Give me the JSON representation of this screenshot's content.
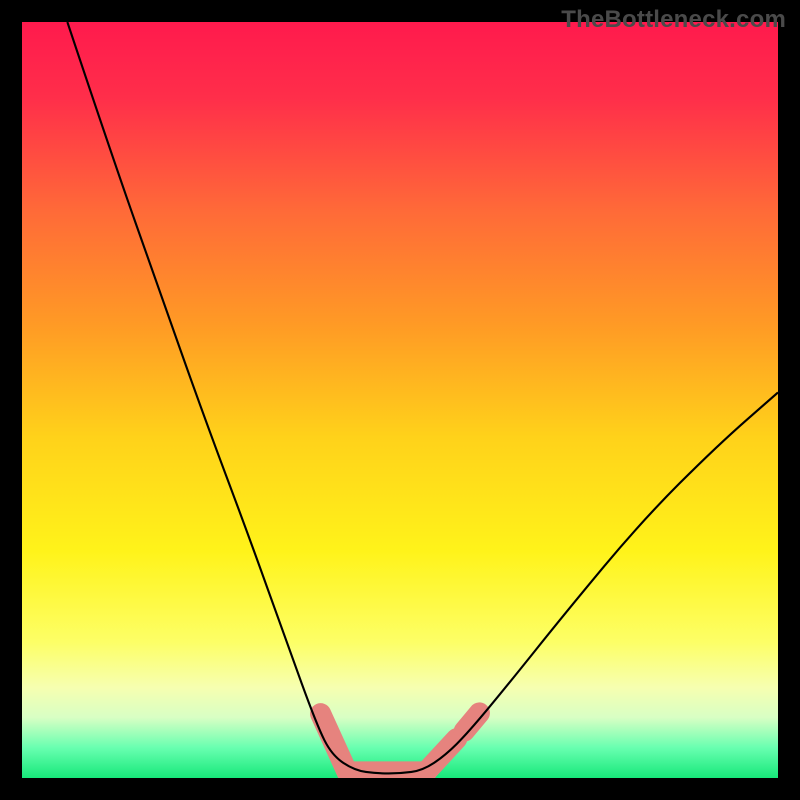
{
  "attribution": "TheBottleneck.com",
  "chart_data": {
    "type": "line",
    "title": "",
    "xlabel": "",
    "ylabel": "",
    "xlim": [
      0,
      100
    ],
    "ylim": [
      0,
      100
    ],
    "grid": false,
    "legend": false,
    "gradient_stops": [
      {
        "offset": 0.0,
        "color": "#ff1a4d"
      },
      {
        "offset": 0.1,
        "color": "#ff2e4a"
      },
      {
        "offset": 0.25,
        "color": "#ff6a38"
      },
      {
        "offset": 0.4,
        "color": "#ff9a25"
      },
      {
        "offset": 0.55,
        "color": "#ffd21a"
      },
      {
        "offset": 0.7,
        "color": "#fff31a"
      },
      {
        "offset": 0.82,
        "color": "#fdff66"
      },
      {
        "offset": 0.88,
        "color": "#f6ffb0"
      },
      {
        "offset": 0.92,
        "color": "#d8ffc4"
      },
      {
        "offset": 0.96,
        "color": "#68ffb0"
      },
      {
        "offset": 1.0,
        "color": "#17e87a"
      }
    ],
    "series": [
      {
        "name": "curve",
        "stroke": "#000000",
        "points": [
          {
            "x": 6,
            "y": 100
          },
          {
            "x": 12,
            "y": 82
          },
          {
            "x": 18,
            "y": 65
          },
          {
            "x": 24,
            "y": 48
          },
          {
            "x": 30,
            "y": 32
          },
          {
            "x": 35,
            "y": 18
          },
          {
            "x": 39,
            "y": 7
          },
          {
            "x": 41,
            "y": 3
          },
          {
            "x": 44,
            "y": 1
          },
          {
            "x": 47,
            "y": 0.6
          },
          {
            "x": 50,
            "y": 0.6
          },
          {
            "x": 53,
            "y": 1
          },
          {
            "x": 56,
            "y": 3
          },
          {
            "x": 59,
            "y": 6
          },
          {
            "x": 64,
            "y": 12
          },
          {
            "x": 72,
            "y": 22
          },
          {
            "x": 82,
            "y": 34
          },
          {
            "x": 92,
            "y": 44
          },
          {
            "x": 100,
            "y": 51
          }
        ]
      }
    ],
    "markers": {
      "name": "highlight-band",
      "fill": "#e6837e",
      "segments": [
        {
          "x1": 39.5,
          "y1": 8.5,
          "x2": 43.0,
          "y2": 0.8
        },
        {
          "x1": 43.5,
          "y1": 0.8,
          "x2": 53.5,
          "y2": 0.8
        },
        {
          "x1": 53.8,
          "y1": 1.2,
          "x2": 57.5,
          "y2": 5.2
        },
        {
          "x1": 58.5,
          "y1": 6.2,
          "x2": 60.5,
          "y2": 8.6
        }
      ],
      "radius": 1.4
    }
  }
}
